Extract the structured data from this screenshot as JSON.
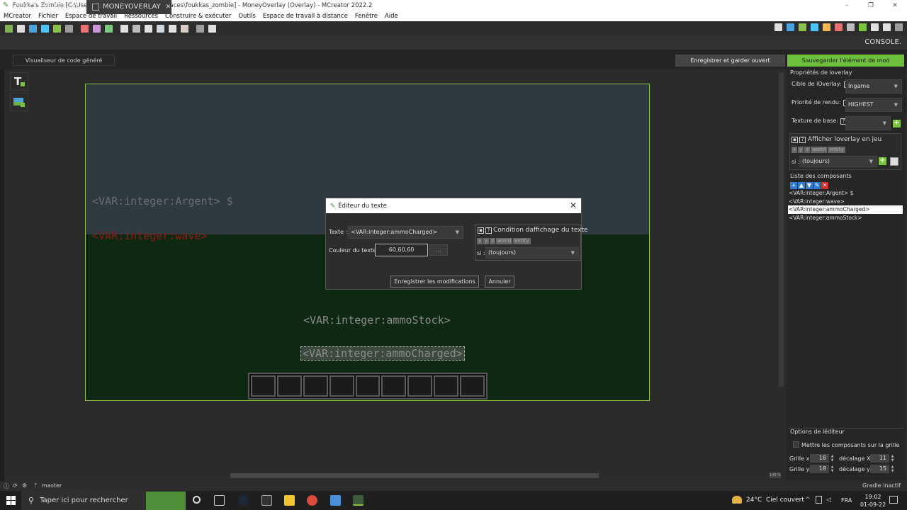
{
  "window": {
    "title": "Foukka's Zombie [C:\\Users\\bradley\\MCreatorWorkspaces\\foukkas_zombie] - MoneyOverlay (Overlay) - MCreator 2022.2",
    "minimize": "–",
    "maximize": "❐",
    "close": "✕"
  },
  "menu": [
    "MCreator",
    "Fichier",
    "Espace de travail",
    "Ressources",
    "Construire & exécuter",
    "Outils",
    "Espace de travail à distance",
    "Fenêtre",
    "Aide"
  ],
  "tabs": {
    "workspace": "ESPACE DE TRAVAIL",
    "current": "MONEYOVERLAY",
    "close": "✕",
    "console": "CONSOLE."
  },
  "subbar": {
    "code_viewer": "Visualiseur de code généré",
    "save_keep": "Enregistrer et garder ouvert",
    "save_mod": "Sauvegarder l'élément de mod"
  },
  "canvas": {
    "texts": {
      "argent": "<VAR:integer:Argent> $",
      "wave": "<VAR:integer:wave>",
      "stock": "<VAR:integer:ammoStock>",
      "charged": "<VAR:integer:ammoCharged>"
    },
    "colors": {
      "sky": "#2f3940",
      "grass": "#0f2812",
      "wave": "#8a1d1d"
    },
    "hotbar_slots": 9
  },
  "properties": {
    "title": "Propriétés de loverlay",
    "target_label": "Cible de lOverlay:",
    "target_value": "Ingame",
    "priority_label": "Priorité de rendu:",
    "priority_value": "HIGHEST",
    "texture_label": "Texture de base:",
    "texture_value": "",
    "show_label": "Afficher loverlay en jeu",
    "chips": [
      "x",
      "y",
      "z",
      "world",
      "entity"
    ],
    "si_label": "si :",
    "si_value": "(toujours)"
  },
  "components": {
    "title": "Liste des composants",
    "items": [
      "<VAR:integer:Argent> $",
      "<VAR:integer:wave>",
      "<VAR:integer:ammoCharged>",
      "<VAR:integer:ammoStock>"
    ],
    "selected_index": 2
  },
  "editor_options": {
    "title": "Options de léditeur",
    "snap_label": "Mettre les composants sur la grille",
    "grid_x_label": "Grille x:",
    "grid_x": "18",
    "offset_x_label": "décalage X:",
    "offset_x": "11",
    "grid_y_label": "Grille y:",
    "grid_y": "18",
    "offset_y_label": "décalage y:",
    "offset_y": "15"
  },
  "dialog": {
    "title": "Éditeur du texte",
    "text_label": "Texte :",
    "text_value": "<VAR:integer:ammoCharged>",
    "color_label": "Couleur du texte :",
    "color_value": "60,60,60",
    "color_picker": "...",
    "condition_title": "Condition daffichage du texte",
    "chips": [
      "x",
      "y",
      "z",
      "world",
      "entity"
    ],
    "si_label": "si :",
    "si_value": "(toujours)",
    "save_button": "Enregistrer les modifications",
    "cancel_button": "Annuler"
  },
  "status": {
    "branch": "master",
    "gradle": "Gradle inactif",
    "zoom": "140 %"
  },
  "taskbar": {
    "search_placeholder": "Taper ici pour rechercher",
    "weather": "24°C  Ciel couvert",
    "lang": "FRA",
    "time": "19:02",
    "date": "01-09-22"
  }
}
